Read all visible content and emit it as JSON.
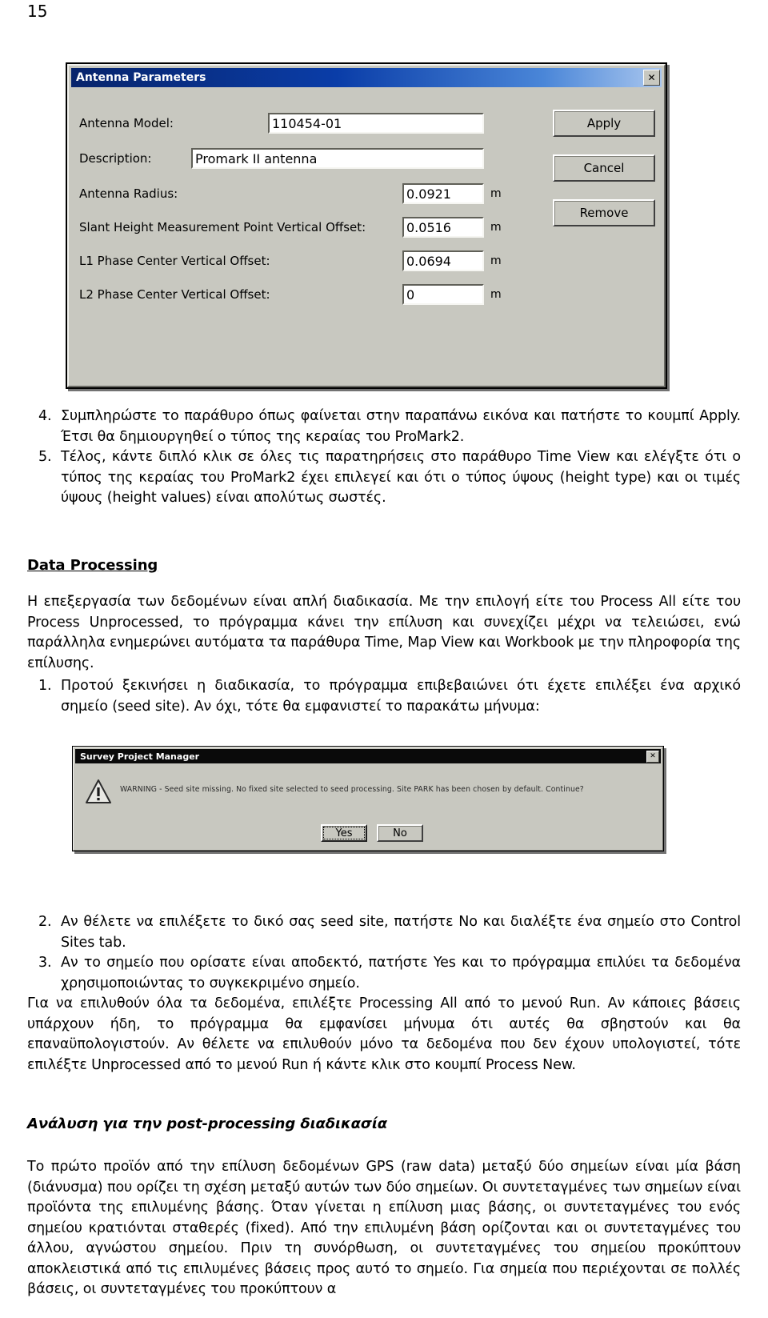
{
  "page": {
    "number": "15"
  },
  "antenna_dialog": {
    "title": "Antenna Parameters",
    "close_label": "✕",
    "fields": [
      {
        "label": "Antenna Model:",
        "value": "110454-01",
        "unit": ""
      },
      {
        "label": "Description:",
        "value": "Promark II antenna",
        "unit": ""
      },
      {
        "label": "Antenna Radius:",
        "value": "0.0921",
        "unit": "m"
      },
      {
        "label": "Slant Height Measurement Point Vertical Offset:",
        "value": "0.0516",
        "unit": "m"
      },
      {
        "label": "L1 Phase Center Vertical Offset:",
        "value": "0.0694",
        "unit": "m"
      },
      {
        "label": "L2 Phase Center Vertical Offset:",
        "value": "0",
        "unit": "m"
      }
    ],
    "buttons": [
      {
        "label": "Apply"
      },
      {
        "label": "Cancel"
      },
      {
        "label": "Remove"
      }
    ]
  },
  "warning_dialog": {
    "title": "Survey Project Manager",
    "close_label": "✕",
    "message": "WARNING - Seed site missing. No fixed site selected to seed processing. Site PARK has been chosen by default. Continue?",
    "buttons": [
      {
        "label": "Yes",
        "default": true
      },
      {
        "label": "No",
        "default": false
      }
    ]
  },
  "content": {
    "list_a": [
      {
        "num": "4.",
        "text": "Συμπληρώστε το παράθυρο όπως φαίνεται στην παραπάνω εικόνα και πατήστε το κουμπί Apply. Έτσι θα δημιουργηθεί ο τύπος της κεραίας του ProMark2."
      },
      {
        "num": "5.",
        "text": "Τέλος, κάντε διπλό κλικ σε όλες τις παρατηρήσεις στο παράθυρο Time View και ελέγξτε ότι ο τύπος της κεραίας του ProMark2 έχει επιλεγεί και ότι ο τύπος ύψους (height type) και οι τιμές ύψους (height values) είναι απολύτως σωστές."
      }
    ],
    "heading_data_processing": "Data Processing",
    "para_processing": "Η επεξεργασία των δεδομένων είναι απλή διαδικασία. Με την επιλογή είτε του Process All είτε του Process Unprocessed, το πρόγραμμα κάνει την επίλυση και συνεχίζει μέχρι να τελειώσει, ενώ παράλληλα ενημερώνει αυτόματα τα παράθυρα Time, Map View και Workbook με την πληροφορία της επίλυσης.",
    "list_b_item1": {
      "num": "1.",
      "text": "Προτού ξεκινήσει η διαδικασία, το πρόγραμμα επιβεβαιώνει ότι έχετε επιλέξει ένα αρχικό σημείο (seed site). Αν όχι, τότε θα εμφανιστεί το παρακάτω μήνυμα:"
    },
    "list_c": [
      {
        "num": "2.",
        "text": "Αν θέλετε να επιλέξετε το δικό σας seed site, πατήστε No και διαλέξτε ένα σημείο στο Control Sites tab."
      },
      {
        "num": "3.",
        "text": "Αν το σημείο που ορίσατε είναι αποδεκτό, πατήστε Yes και το πρόγραμμα επιλύει τα δεδομένα χρησιμοποιώντας το συγκεκριμένο σημείο."
      }
    ],
    "para_run_menu": "Για να επιλυθούν όλα τα δεδομένα, επιλέξτε Processing All από το μενού Run. Αν κάποιες βάσεις υπάρχουν ήδη, το πρόγραμμα θα εμφανίσει μήνυμα ότι αυτές θα σβηστούν και θα επαναϋπολογιστούν. Αν θέλετε να επιλυθούν μόνο τα δεδομένα που δεν έχουν υπολογιστεί, τότε επιλέξτε Unprocessed από το μενού Run ή κάντε κλικ στο κουμπί Process New.",
    "heading_analysis": "Ανάλυση για την post-processing διαδικασία",
    "para_analysis": "Το πρώτο προϊόν από την επίλυση δεδομένων GPS (raw data) μεταξύ δύο σημείων είναι μία βάση (διάνυσμα) που ορίζει τη σχέση μεταξύ αυτών των δύο σημείων. Οι συντεταγμένες των σημείων είναι προϊόντα της επιλυμένης βάσης. Όταν γίνεται η επίλυση μιας βάσης, οι συντεταγμένες του ενός σημείου κρατιόνται σταθερές (fixed). Από την επιλυμένη βάση ορίζονται και οι συντεταγμένες του άλλου, αγνώστου σημείου. Πριν τη συνόρθωση, οι συντεταγμένες του σημείου προκύπτουν αποκλειστικά από τις επιλυμένες βάσεις προς αυτό το σημείο. Για σημεία που περιέχονται σε πολλές βάσεις, οι συντεταγμένες του προκύπτουν α"
  },
  "colors": {
    "dialog_face": "#c8c8c0",
    "titlebar_start": "#08246b",
    "titlebar_end": "#a9c6ee",
    "field_bg": "#ffffff",
    "text": "#000000"
  }
}
